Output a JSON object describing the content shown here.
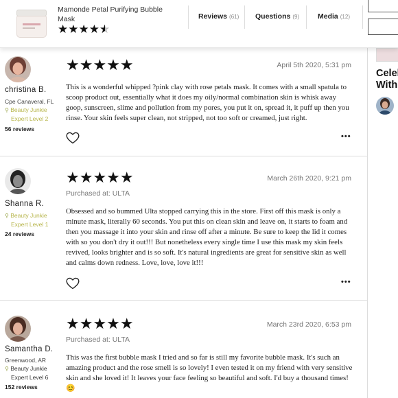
{
  "header": {
    "product_title": "Mamonde Petal Purifying Bubble Mask",
    "rating_stars": 4.5,
    "tabs": [
      {
        "label": "Reviews",
        "count": "(61)"
      },
      {
        "label": "Questions",
        "count": "(9)"
      },
      {
        "label": "Media",
        "count": "(12)"
      }
    ]
  },
  "reviews": [
    {
      "name": "christina B.",
      "location": "Cpe Canaveral, FL",
      "badge_line1": "Beauty Junkie",
      "badge_line2": "Expert Level 2",
      "review_count": "56 reviews",
      "stars": 5,
      "date": "April 5th 2020, 5:31 pm",
      "purchased_at": "",
      "text": "This is a wonderful whipped ?pink clay with rose petals mask. It comes with a small spatula to scoop product out, essentially what it does my oily/normal combination skin is whisk away goop, sunscreen, slime and pollution from my pores, you put it on, spread it, it puff up then you rinse. Your skin feels super clean, not stripped, not too soft or creamed, just right."
    },
    {
      "name": "Shanna R.",
      "location": "",
      "badge_line1": "Beauty Junkie",
      "badge_line2": "Expert Level 1",
      "review_count": "24 reviews",
      "stars": 5,
      "date": "March 26th 2020, 9:21 pm",
      "purchased_at": "Purchased at: ULTA",
      "text": "Obsessed and so bummed Ulta stopped carrying this in the store. First off this mask is only a minute mask, literally 60 seconds. You put this on clean skin and leave on, it starts to foam and then you massage it into your skin and rinse off after a minute. Be sure to keep the lid it comes with so you don't dry it out!!! But nonetheless every single time I use this mask my skin feels revived, looks brighter and is so soft. It's natural ingredients are great for sensitive skin as well and calms down redness. Love, love, love it!!!"
    },
    {
      "name": "Samantha D.",
      "location": "Greenwood, AR",
      "badge_line1": "Beauty Junkie",
      "badge_line2": "Expert Level 6",
      "review_count": "152 reviews",
      "stars": 5,
      "date": "March 23rd 2020, 6:53 pm",
      "purchased_at": "Purchased at: ULTA",
      "text": "This was the first bubble mask I tried and so far is still my favorite bubble mask. It's such an amazing product and the rose smell is so lovely! I even tested it on my friend with very sensitive skin and she loved it! It leaves your face feeling so beautiful and soft. I'd buy a thousand times!😊"
    }
  ],
  "sidebar": {
    "title": "Celeb With"
  },
  "icons": {
    "heart": "heart-icon",
    "more": "more-options-icon",
    "pin": "location-pin-icon"
  },
  "colors": {
    "star": "#111111",
    "badge_gold": "#b7b54a",
    "muted_text": "#777777"
  }
}
